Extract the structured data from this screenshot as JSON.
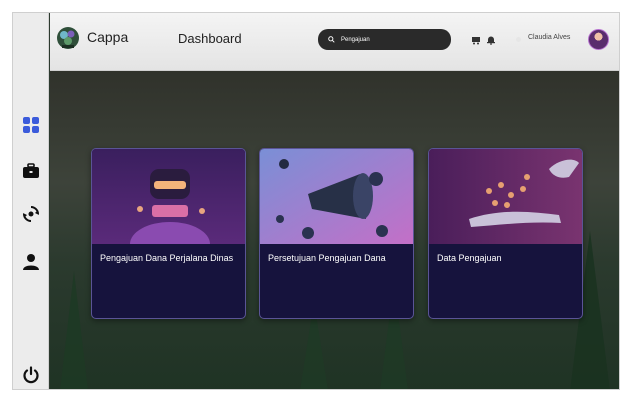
{
  "app": {
    "brand": "Cappa",
    "page_title": "Dashboard"
  },
  "search": {
    "value": "Pengajuan"
  },
  "user": {
    "name": "Claudia Alves"
  },
  "sidebar": {
    "items": [
      {
        "icon": "grid-icon",
        "active": true
      },
      {
        "icon": "briefcase-icon",
        "active": false
      },
      {
        "icon": "refresh-icon",
        "active": false
      },
      {
        "icon": "user-icon",
        "active": false
      },
      {
        "icon": "power-icon",
        "active": false
      }
    ]
  },
  "cards": [
    {
      "label": "Pengajuan Dana Perjalana Dinas"
    },
    {
      "label": "Persetujuan Pengajuan Dana"
    },
    {
      "label": "Data Pengajuan"
    }
  ],
  "colors": {
    "accent": "#3b5bdb",
    "card_bg": "#16133d",
    "sidebar_bg": "#ececec"
  }
}
